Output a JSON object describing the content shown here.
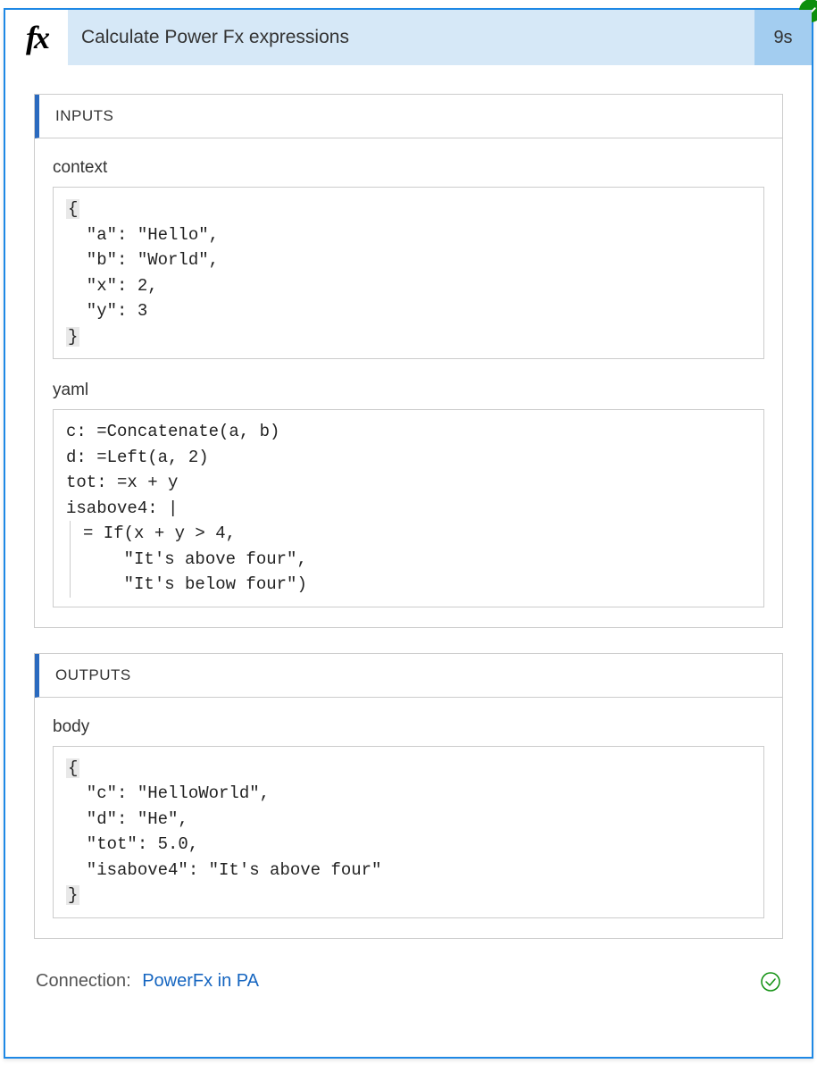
{
  "header": {
    "icon_text": "fx",
    "title": "Calculate Power Fx expressions",
    "duration": "9s"
  },
  "inputs": {
    "section_title": "INPUTS",
    "context_label": "context",
    "context_code": "{\n  \"a\": \"Hello\",\n  \"b\": \"World\",\n  \"x\": 2,\n  \"y\": 3\n}",
    "yaml_label": "yaml",
    "yaml_code": "c: =Concatenate(a, b)\nd: =Left(a, 2)\ntot: =x + y\nisabove4: |\n  = If(x + y > 4,\n      \"It's above four\",\n      \"It's below four\")"
  },
  "outputs": {
    "section_title": "OUTPUTS",
    "body_label": "body",
    "body_code": "{\n  \"c\": \"HelloWorld\",\n  \"d\": \"He\",\n  \"tot\": 5.0,\n  \"isabove4\": \"It's above four\"\n}"
  },
  "footer": {
    "connection_label": "Connection:",
    "connection_link": "PowerFx in PA"
  }
}
